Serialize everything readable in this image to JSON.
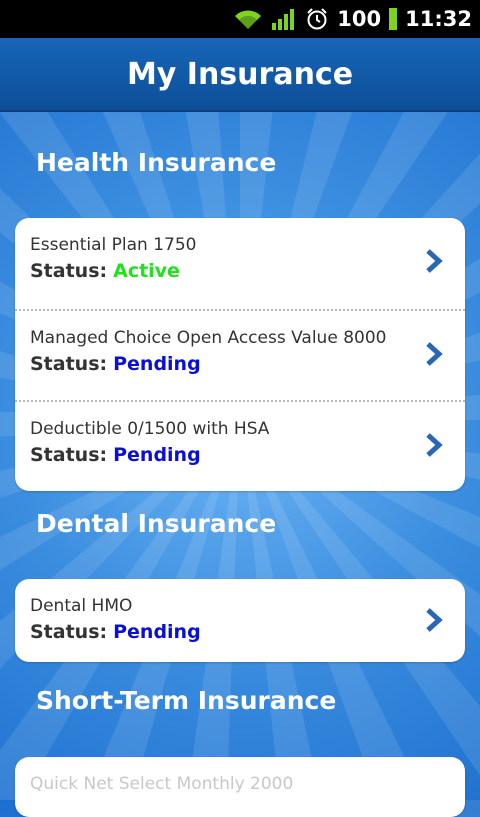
{
  "status_bar": {
    "battery_level": "100",
    "time": "11:32",
    "icons": [
      "wifi-icon",
      "signal-icon",
      "alarm-icon",
      "battery-icon"
    ]
  },
  "header": {
    "title": "My Insurance"
  },
  "colors": {
    "active": "#22e01e",
    "pending": "#0a0fd6",
    "header": "#1766b8",
    "chevron": "#2a66b8"
  },
  "sections": [
    {
      "title": "Health Insurance",
      "plans": [
        {
          "name": "Essential Plan 1750",
          "status_label": "Status:",
          "status": "Active"
        },
        {
          "name": "Managed Choice Open Access Value 8000",
          "status_label": "Status:",
          "status": "Pending"
        },
        {
          "name": "Deductible 0/1500 with HSA",
          "status_label": "Status:",
          "status": "Pending"
        }
      ]
    },
    {
      "title": "Dental Insurance",
      "plans": [
        {
          "name": "Dental HMO",
          "status_label": "Status:",
          "status": "Pending"
        }
      ]
    },
    {
      "title": "Short-Term Insurance",
      "plans": [
        {
          "name": "Quick Net Select Monthly 2000"
        }
      ]
    }
  ]
}
